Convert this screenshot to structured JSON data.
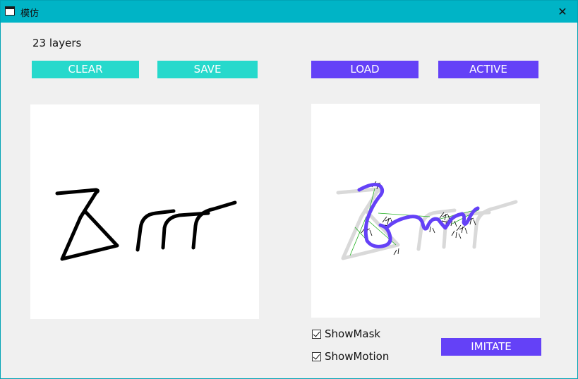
{
  "window": {
    "title": "模仿",
    "close_glyph": "✕"
  },
  "status": {
    "layers_text": "23 layers"
  },
  "buttons": {
    "clear": "CLEAR",
    "save": "SAVE",
    "load": "LOAD",
    "active": "ACTIVE",
    "imitate": "IMITATE"
  },
  "options": {
    "show_mask": {
      "label": "ShowMask",
      "checked": true
    },
    "show_motion": {
      "label": "ShowMotion",
      "checked": true
    }
  },
  "colors": {
    "title_bar": "#00b4c6",
    "teal_button": "#26d9cc",
    "purple_button": "#6441f7",
    "stroke_black": "#000000",
    "stroke_purple": "#6441f7",
    "mask_gray": "#d9d9d9",
    "motion_green": "#22b022"
  },
  "icons": [
    "app-window-icon",
    "close-icon",
    "checkbox-checked-icon"
  ]
}
